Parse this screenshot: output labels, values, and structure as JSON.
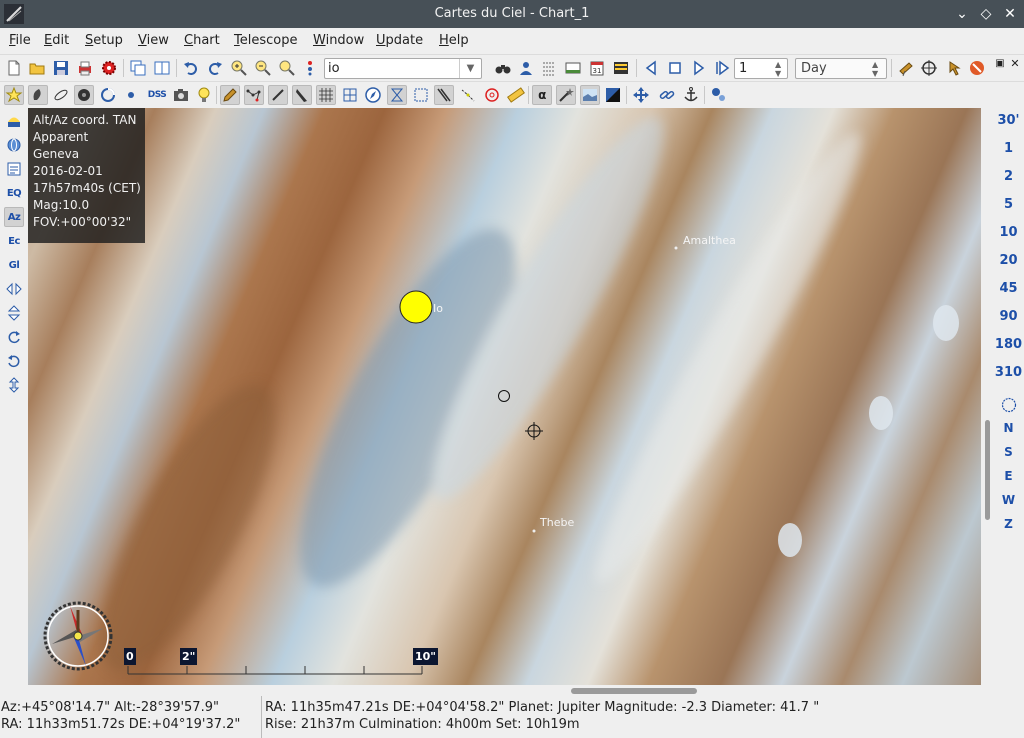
{
  "window": {
    "title": "Cartes du Ciel - Chart_1"
  },
  "menu": [
    {
      "label": "File",
      "key": "F",
      "rest": "ile"
    },
    {
      "label": "Edit",
      "key": "E",
      "rest": "dit"
    },
    {
      "label": "Setup",
      "key": "S",
      "rest": "etup"
    },
    {
      "label": "View",
      "key": "V",
      "rest": "iew"
    },
    {
      "label": "Chart",
      "key": "C",
      "rest": "hart"
    },
    {
      "label": "Telescope",
      "key": "T",
      "rest": "elescope"
    },
    {
      "label": "Window",
      "key": "W",
      "rest": "indow"
    },
    {
      "label": "Update",
      "key": "U",
      "rest": "pdate"
    },
    {
      "label": "Help",
      "key": "H",
      "rest": "elp"
    }
  ],
  "toolbar": {
    "search_value": "io",
    "step_value": "1",
    "step_unit": "Day",
    "dss_label": "DSS",
    "alpha_label": "α"
  },
  "left_toolbar": {
    "eq_label": "EQ",
    "az_label": "Az",
    "ec_label": "Ec",
    "gl_label": "Gl"
  },
  "fov_buttons": [
    "30'",
    "1",
    "2",
    "5",
    "10",
    "20",
    "45",
    "90",
    "180",
    "310"
  ],
  "direction_buttons": [
    "N",
    "S",
    "E",
    "W",
    "Z"
  ],
  "chart_info": {
    "coord": "Alt/Az coord. TAN",
    "mode": "Apparent",
    "location": "Geneva",
    "date": "2016-02-01",
    "time": "17h57m40s (CET)",
    "mag": "Mag:10.0",
    "fov": "FOV:+00°00'32\""
  },
  "objects": {
    "io": "Io",
    "amalthea": "Amalthea",
    "thebe": "Thebe"
  },
  "scale": {
    "zero": "0",
    "two": "2\"",
    "ten": "10\""
  },
  "status": {
    "altaz": "Az:+45°08'14.7\" Alt:-28°39'57.9\"",
    "radec_cursor": "RA: 11h33m51.72s DE:+04°19'37.2\"",
    "object_line": "RA: 11h35m47.21s DE:+04°04'58.2\"  Planet: Jupiter  Magnitude:  -2.3  Diameter:  41.7 \"",
    "rise_line": "Rise: 21h37m   Culmination:  4h00m   Set: 10h19m"
  }
}
